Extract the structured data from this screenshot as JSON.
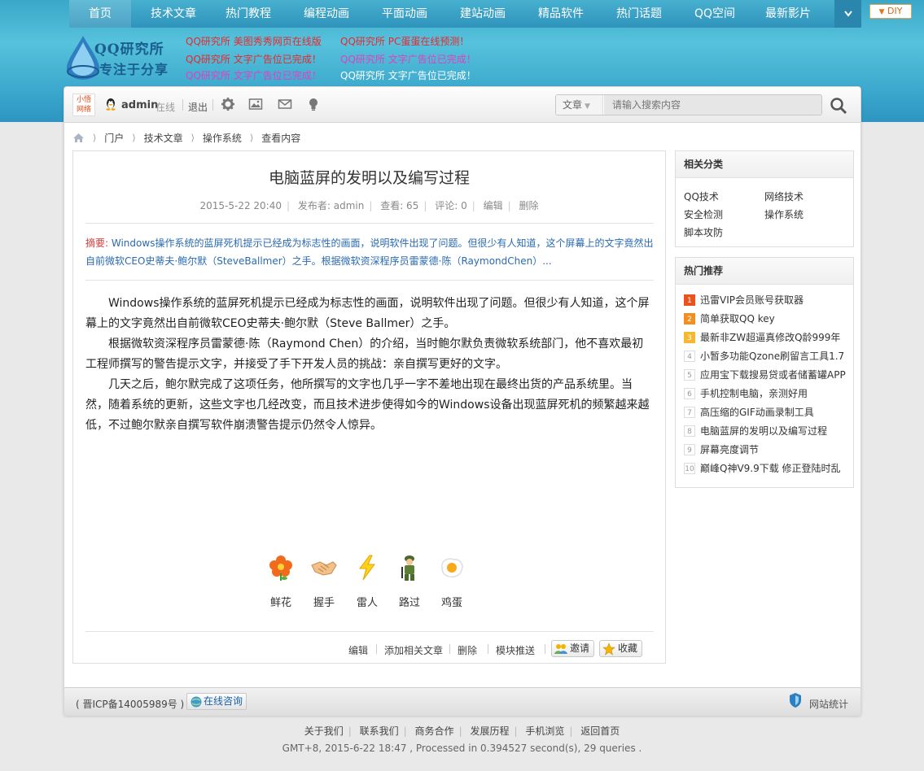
{
  "nav": {
    "items": [
      "首页",
      "技术文章",
      "热门教程",
      "编程动画",
      "平面动画",
      "建站动画",
      "精品软件",
      "热门话题",
      "QQ空间",
      "最新影片"
    ],
    "more_icon": "chevron-down-icon",
    "diy_label": "DIY"
  },
  "logo": {
    "top": "QQ研究所",
    "bottom": "专注于分享"
  },
  "ads": [
    "QQ研究所 美图秀秀网页在线版",
    "QQ研究所 PC蛋蛋在线预测！",
    "QQ研究所 文字广告位已完成！",
    "QQ研究所 文字广告位已完成！",
    "QQ研究所 文字广告位已完成！",
    "QQ研究所 文字广告位已完成！"
  ],
  "toolbar": {
    "site_badge": "小悟网络",
    "username": "admin",
    "status": "在线",
    "logout": "退出",
    "search_type": "文章",
    "search_placeholder": "请输入搜索内容"
  },
  "breadcrumb": [
    "门户",
    "技术文章",
    "操作系统",
    "查看内容"
  ],
  "article": {
    "title": "电脑蓝屏的发明以及编写过程",
    "date": "2015-5-22 20:40",
    "author": "发布者: admin",
    "views": "查看: 65",
    "comments": "评论: 0",
    "edit": "编辑",
    "delete": "删除",
    "summary_label": "摘要:",
    "summary_text": "Windows操作系统的蓝屏死机提示已经成为标志性的画面，说明软件出现了问题。但很少有人知道，这个屏幕上的文字竟然出自前微软CEO史蒂夫·鲍尔默（SteveBallmer）之手。根据微软资深程序员雷蒙德·陈（RaymondChen）...",
    "paragraphs": [
      "Windows操作系统的蓝屏死机提示已经成为标志性的画面，说明软件出现了问题。但很少有人知道，这个屏幕上的文字竟然出自前微软CEO史蒂夫·鲍尔默（Steve Ballmer）之手。",
      "根据微软资深程序员雷蒙德·陈（Raymond Chen）的介绍，当时鲍尔默负责微软系统部门，他不喜欢最初工程师撰写的警告提示文字，并接受了手下开发人员的挑战：亲自撰写更好的文字。",
      "几天之后，鲍尔默完成了这项任务，他所撰写的文字也几乎一字不差地出现在最终出货的产品系统里。当然，随着系统的更新，这些文字也几经改变，而且技术进步使得如今的Windows设备出现蓝屏死机的频繁越来越低，不过鲍尔默亲自撰写软件崩溃警告提示仍然令人惊异。"
    ],
    "reactions": [
      "鲜花",
      "握手",
      "雷人",
      "路过",
      "鸡蛋"
    ],
    "footer": {
      "edit": "编辑",
      "add_related": "添加相关文章",
      "delete": "删除",
      "push": "模块推送",
      "invite": "邀请",
      "favorite": "收藏"
    }
  },
  "sidebar": {
    "related_title": "相关分类",
    "categories": [
      "QQ技术",
      "网络技术",
      "安全检测",
      "操作系统",
      "脚本攻防"
    ],
    "hot_title": "热门推荐",
    "hot": [
      "迅雷VIP会员账号获取器",
      "简单获取QQ key",
      "最新非ZW超逼真修改Q龄999年",
      "小暂多功能Qzone刷留言工具1.7",
      "应用宝下载搜易贷或者储蓄罐APP",
      "手机控制电脑，亲测好用",
      "高压缩的GIF动画录制工具",
      "电脑蓝屏的发明以及编写过程",
      "屏幕亮度调节",
      "巅峰Q神V9.9下载 修正登陆时乱"
    ],
    "hot_ranks": [
      "1",
      "2",
      "3",
      "4",
      "5",
      "6",
      "7",
      "8",
      "9",
      "10"
    ]
  },
  "wrap_footer": {
    "icp": "( 晋ICP备14005989号 )",
    "consult": "在线咨询",
    "stats": "网站统计"
  },
  "page_footer": {
    "links": [
      "关于我们",
      "联系我们",
      "商务合作",
      "发展历程",
      "手机浏览",
      "返回首页"
    ],
    "info": "GMT+8, 2015-6-22 18:47 , Processed in 0.394527 second(s), 29 queries ."
  },
  "colors": {
    "banner": "#3aa7c9",
    "ad_red": "#e8282f",
    "ad_pink": "#e040c0",
    "ad_white": "#ffffff",
    "link_blue": "#2a6ab0"
  }
}
